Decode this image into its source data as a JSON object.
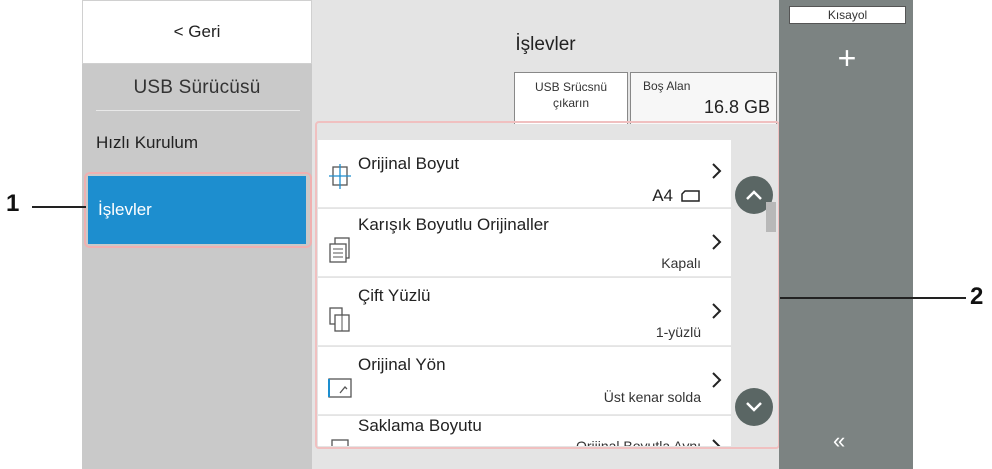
{
  "left_panel": {
    "back_label": "< Geri",
    "section_title": "USB Sürücüsü",
    "menu_items": [
      {
        "label": "Hızlı Kurulum"
      },
      {
        "label": "İşlevler"
      }
    ]
  },
  "header": {
    "title": "İşlevler",
    "remove_usb_line1": "USB Srücsnü",
    "remove_usb_line2": "çıkarın",
    "free_space_label": "Boş Alan",
    "free_space_value": "16.8 GB"
  },
  "function_list": [
    {
      "title": "Orijinal Boyut",
      "value": "A4",
      "icon": "original-size-icon"
    },
    {
      "title": "Karışık Boyutlu Orijinaller",
      "value": "Kapalı",
      "icon": "mixed-originals-icon"
    },
    {
      "title": "Çift Yüzlü",
      "value": "1-yüzlü",
      "icon": "duplex-icon"
    },
    {
      "title": "Orijinal Yön",
      "value": "Üst kenar solda",
      "icon": "orientation-icon"
    },
    {
      "title": "Saklama Boyutu",
      "value": "Orijinal Boyutla Aynı",
      "icon": "store-size-icon"
    }
  ],
  "right_panel": {
    "shortcut_label": "Kısayol",
    "add_label": "+",
    "collapse_label": "«"
  },
  "callouts": {
    "one": "1",
    "two": "2"
  },
  "colors": {
    "selected": "#1d8ecf",
    "left_bg": "#c9c9c9",
    "center_bg": "#e4e4e4",
    "right_bg": "#7c8382",
    "scroll_button": "#5a6664"
  }
}
